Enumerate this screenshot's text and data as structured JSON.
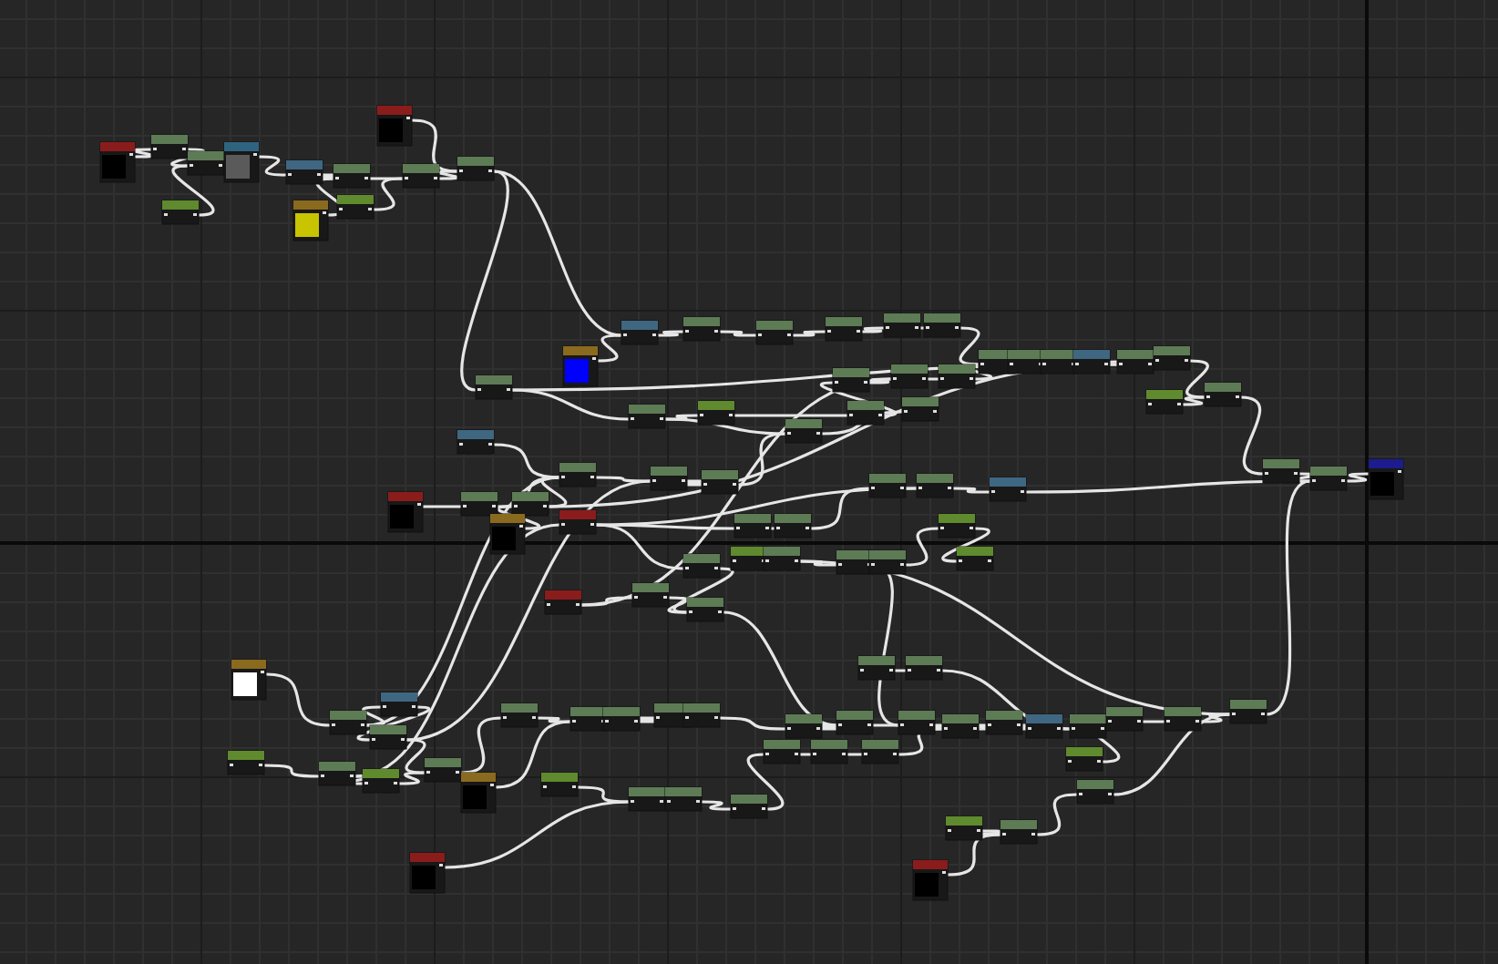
{
  "graph": {
    "nodes": [
      {
        "kind": "preview",
        "color": "#8b1c1c",
        "preview": {
          "color": "#000000"
        }
      },
      {
        "kind": "value",
        "color": "#5d7b55"
      },
      {
        "kind": "value",
        "color": "#5d7b55"
      },
      {
        "kind": "preview",
        "color": "#2f6480",
        "preview": {
          "color": "#5a5a5a"
        }
      },
      {
        "kind": "value",
        "color": "#5f8a2e"
      },
      {
        "kind": "value",
        "color": "#3f6782"
      },
      {
        "kind": "value",
        "color": "#5d7b55"
      },
      {
        "kind": "preview",
        "color": "#8a6a1e",
        "preview": {
          "color": "#c8c400"
        }
      },
      {
        "kind": "value",
        "color": "#5f8a2e"
      },
      {
        "kind": "value",
        "color": "#5d7b55"
      },
      {
        "kind": "preview",
        "color": "#8b1c1c",
        "preview": {
          "color": "#000000"
        }
      },
      {
        "kind": "value",
        "color": "#5d7b55"
      },
      {
        "kind": "preview",
        "color": "#8a6a1e",
        "preview": {
          "color": "#0000ff"
        }
      },
      {
        "kind": "value",
        "color": "#3f6782"
      },
      {
        "kind": "value",
        "color": "#5d7b55"
      },
      {
        "kind": "value",
        "color": "#5d7b55"
      },
      {
        "kind": "value",
        "color": "#5d7b55"
      },
      {
        "kind": "value",
        "color": "#5d7b55"
      },
      {
        "kind": "value",
        "color": "#5d7b55"
      },
      {
        "kind": "value",
        "color": "#5d7b55"
      },
      {
        "kind": "value",
        "color": "#5d7b55"
      },
      {
        "kind": "value",
        "color": "#5f8a2e"
      },
      {
        "kind": "value",
        "color": "#5d7b55"
      },
      {
        "kind": "value",
        "color": "#5d7b55"
      },
      {
        "kind": "value",
        "color": "#5d7b55"
      },
      {
        "kind": "value",
        "color": "#5d7b55"
      },
      {
        "kind": "value",
        "color": "#5d7b55"
      },
      {
        "kind": "value",
        "color": "#5d7b55"
      },
      {
        "kind": "value",
        "color": "#3f6782"
      },
      {
        "kind": "preview",
        "color": "#8b1c1c",
        "preview": {
          "color": "#000000"
        }
      },
      {
        "kind": "value",
        "color": "#5d7b55"
      },
      {
        "kind": "value",
        "color": "#5d7b55"
      },
      {
        "kind": "value",
        "color": "#5d7b55"
      },
      {
        "kind": "value",
        "color": "#5d7b55"
      },
      {
        "kind": "value",
        "color": "#5d7b55"
      },
      {
        "kind": "preview",
        "color": "#8a6a1e",
        "preview": {
          "color": "#000000"
        }
      },
      {
        "kind": "value",
        "color": "#8b1c1c"
      },
      {
        "kind": "value",
        "color": "#5d7b55"
      },
      {
        "kind": "value",
        "color": "#5d7b55"
      },
      {
        "kind": "value",
        "color": "#5f8a2e"
      },
      {
        "kind": "value",
        "color": "#5d7b55"
      },
      {
        "kind": "value",
        "color": "#5d7b55"
      },
      {
        "kind": "value",
        "color": "#5d7b55"
      },
      {
        "kind": "value",
        "color": "#5d7b55"
      },
      {
        "kind": "value",
        "color": "#8b1c1c"
      },
      {
        "kind": "value",
        "color": "#5d7b55"
      },
      {
        "kind": "value",
        "color": "#5d7b55"
      },
      {
        "kind": "value",
        "color": "#3f6782"
      },
      {
        "kind": "value",
        "color": "#5f8a2e"
      },
      {
        "kind": "value",
        "color": "#5f8a2e"
      },
      {
        "kind": "value",
        "color": "#5d7b55"
      },
      {
        "kind": "value",
        "color": "#5d7b55"
      },
      {
        "kind": "value",
        "color": "#5d7b55"
      },
      {
        "kind": "value",
        "color": "#5d7b55"
      },
      {
        "kind": "value",
        "color": "#5d7b55"
      },
      {
        "kind": "value",
        "color": "#3f6782"
      },
      {
        "kind": "value",
        "color": "#5d7b55"
      },
      {
        "kind": "value",
        "color": "#5d7b55"
      },
      {
        "kind": "value",
        "color": "#5f8a2e"
      },
      {
        "kind": "value",
        "color": "#5d7b55"
      },
      {
        "kind": "value",
        "color": "#5d7b55"
      },
      {
        "kind": "value",
        "color": "#5d7b55"
      },
      {
        "kind": "preview",
        "color": "#1c1c8f",
        "preview": {
          "color": "#000000"
        }
      },
      {
        "kind": "preview",
        "color": "#8a6a1e",
        "preview": {
          "color": "#ffffff"
        }
      },
      {
        "kind": "value",
        "color": "#5d7b55"
      },
      {
        "kind": "value",
        "color": "#3f6782"
      },
      {
        "kind": "value",
        "color": "#5d7b55"
      },
      {
        "kind": "value",
        "color": "#5f8a2e"
      },
      {
        "kind": "value",
        "color": "#5d7b55"
      },
      {
        "kind": "value",
        "color": "#5f8a2e"
      },
      {
        "kind": "value",
        "color": "#5d7b55"
      },
      {
        "kind": "value",
        "color": "#5d7b55"
      },
      {
        "kind": "preview",
        "color": "#8a6a1e",
        "preview": {
          "color": "#000000"
        }
      },
      {
        "kind": "value",
        "color": "#5d7b55"
      },
      {
        "kind": "value",
        "color": "#5d7b55"
      },
      {
        "kind": "value",
        "color": "#5d7b55"
      },
      {
        "kind": "value",
        "color": "#5d7b55"
      },
      {
        "kind": "value",
        "color": "#5f8a2e"
      },
      {
        "kind": "value",
        "color": "#5d7b55"
      },
      {
        "kind": "value",
        "color": "#5d7b55"
      },
      {
        "kind": "value",
        "color": "#5d7b55"
      },
      {
        "kind": "preview",
        "color": "#8b1c1c",
        "preview": {
          "color": "#000000"
        }
      },
      {
        "kind": "value",
        "color": "#5d7b55"
      },
      {
        "kind": "value",
        "color": "#5d7b55"
      },
      {
        "kind": "value",
        "color": "#5d7b55"
      },
      {
        "kind": "value",
        "color": "#5d7b55"
      },
      {
        "kind": "value",
        "color": "#5d7b55"
      },
      {
        "kind": "value",
        "color": "#3f6782"
      },
      {
        "kind": "value",
        "color": "#5d7b55"
      },
      {
        "kind": "value",
        "color": "#5d7b55"
      },
      {
        "kind": "value",
        "color": "#5d7b55"
      },
      {
        "kind": "value",
        "color": "#5d7b55"
      },
      {
        "kind": "value",
        "color": "#5d7b55"
      },
      {
        "kind": "value",
        "color": "#5d7b55"
      },
      {
        "kind": "value",
        "color": "#5d7b55"
      },
      {
        "kind": "value",
        "color": "#5f8a2e"
      },
      {
        "kind": "value",
        "color": "#5d7b55"
      },
      {
        "kind": "value",
        "color": "#5d7b55"
      },
      {
        "kind": "value",
        "color": "#5d7b55"
      },
      {
        "kind": "value",
        "color": "#5f8a2e"
      },
      {
        "kind": "value",
        "color": "#5d7b55"
      },
      {
        "kind": "preview",
        "color": "#8b1c1c",
        "preview": {
          "color": "#000000"
        }
      }
    ]
  }
}
